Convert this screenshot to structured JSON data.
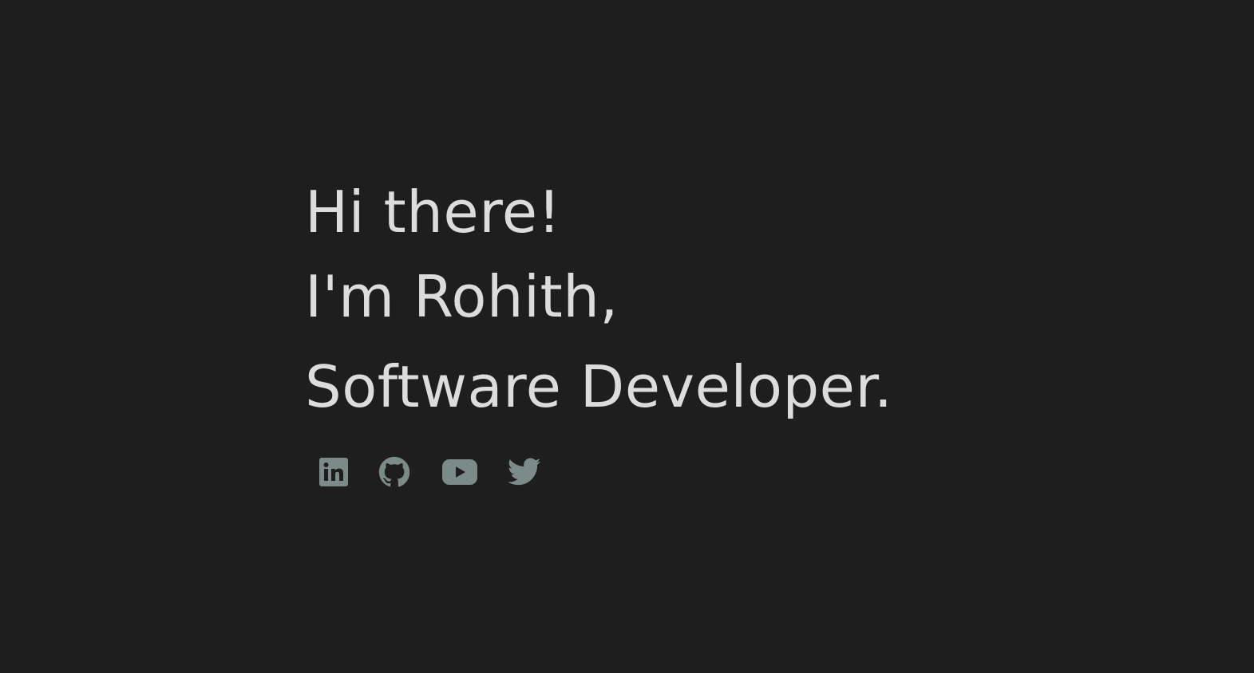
{
  "hero": {
    "greeting": "Hi there!",
    "name_line": "I'm Rohith,",
    "role_line": "Software Developer."
  },
  "socials": [
    {
      "icon": "linkedin-icon",
      "label": "LinkedIn"
    },
    {
      "icon": "github-icon",
      "label": "GitHub"
    },
    {
      "icon": "youtube-icon",
      "label": "YouTube"
    },
    {
      "icon": "twitter-icon",
      "label": "Twitter"
    }
  ],
  "colors": {
    "background": "#1e1e1e",
    "text": "#dcdcdc",
    "icon": "#7c8a88"
  }
}
